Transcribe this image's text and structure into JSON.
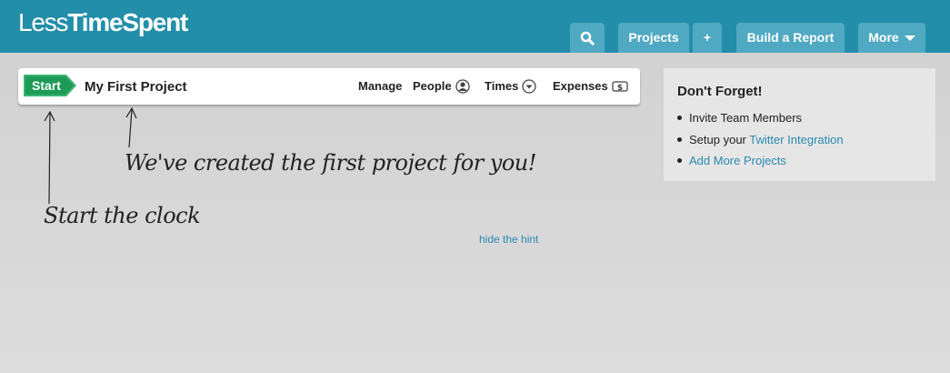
{
  "app": {
    "logo_light": "Less",
    "logo_bold": "TimeSpent"
  },
  "nav": {
    "search_icon": "search-icon",
    "projects": "Projects",
    "add": "+",
    "build_report": "Build a Report",
    "more": "More"
  },
  "project_bar": {
    "start_label": "Start",
    "project_name": "My First Project",
    "links": {
      "manage": "Manage",
      "people": "People",
      "times": "Times",
      "expenses": "Expenses"
    }
  },
  "hints": {
    "created": "We've created the first project for you!",
    "start_clock": "Start the clock",
    "hide": "hide the hint"
  },
  "sidebar": {
    "title": "Don't Forget!",
    "items": {
      "invite": "Invite Team Members",
      "setup_prefix": "Setup your ",
      "twitter_link": "Twitter Integration",
      "add_projects": "Add More Projects"
    }
  },
  "colors": {
    "header_bg": "#238eaa",
    "nav_button": "#4fa9c2",
    "start_green": "#1e9b57",
    "link_blue": "#2a8ab0"
  }
}
